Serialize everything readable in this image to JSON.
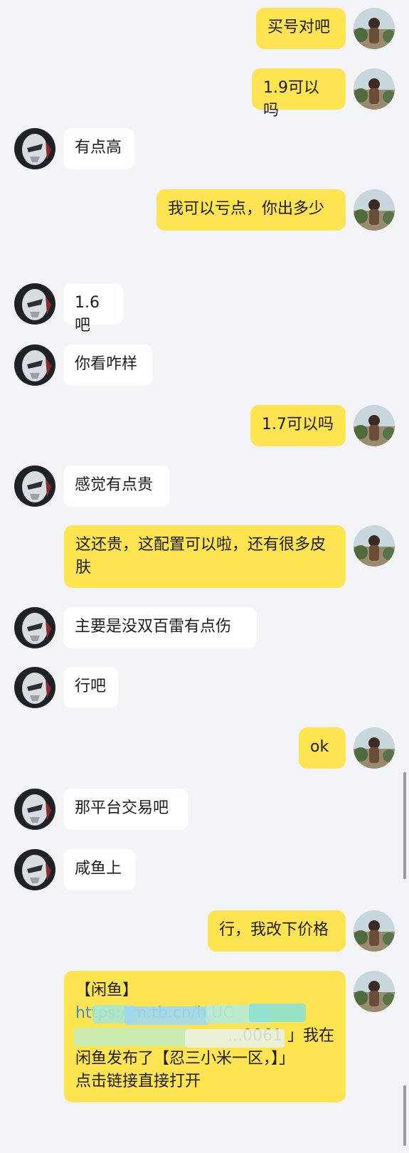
{
  "colors": {
    "background": "#f3f4f8",
    "incoming_bubble": "#ffffff",
    "outgoing_bubble": "#fde450",
    "text": "#1d1d1d"
  },
  "avatars": {
    "me": "user-avatar-icon",
    "contact": "contact-avatar-icon"
  },
  "messages": [
    {
      "side": "right",
      "text": "买号对吧"
    },
    {
      "side": "right",
      "text": "1.9可以吗"
    },
    {
      "side": "left",
      "text": "有点高"
    },
    {
      "side": "right",
      "text": "我可以亏点，你出多少"
    },
    {
      "side": "left",
      "text": "1.6吧"
    },
    {
      "side": "left",
      "text": "你看咋样"
    },
    {
      "side": "right",
      "text": "1.7可以吗"
    },
    {
      "side": "left",
      "text": "感觉有点贵"
    },
    {
      "side": "right",
      "text": "这还贵，这配置可以啦，还有很多皮肤"
    },
    {
      "side": "left",
      "text": "主要是没双百雷有点伤"
    },
    {
      "side": "left",
      "text": "行吧"
    },
    {
      "side": "right",
      "text": "ok"
    },
    {
      "side": "left",
      "text": "那平台交易吧"
    },
    {
      "side": "left",
      "text": "咸鱼上"
    },
    {
      "side": "right",
      "text": "行，我改下价格"
    },
    {
      "side": "right",
      "text_line1": "【闲鱼】",
      "text_link": "https://m.tb.cn/h.UC",
      "text_line3": "...0061 」我在",
      "text_line4": "闲鱼发布了【忍三小米一区，】」",
      "text_line5": "点击链接直接打开"
    }
  ]
}
